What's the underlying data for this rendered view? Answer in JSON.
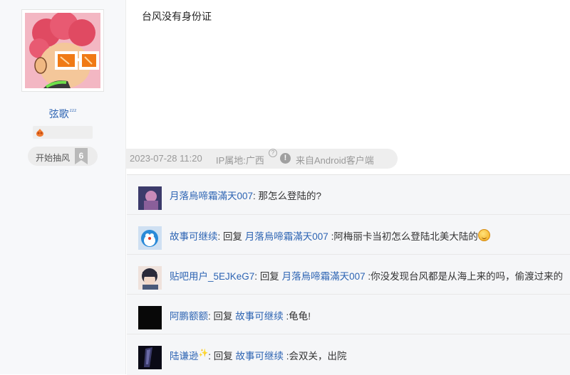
{
  "author": {
    "username": "弦歌",
    "username_suffix": "ᶻᶻᶻ",
    "lottery_label": "开始抽风",
    "lottery_count": "6"
  },
  "post": {
    "text": "台风没有身份证",
    "timestamp": "2023-07-28 11:20",
    "ip_location": "IP属地:广西",
    "help_glyph": "?",
    "warn_glyph": "!",
    "client": "来自Android客户端"
  },
  "comments": [
    {
      "user": "月落烏啼霜滿天007",
      "sep": ": ",
      "reply_word": "",
      "reply_to": "",
      "text": "那怎么登陆的?"
    },
    {
      "user": "故事可继续",
      "sep": ": ",
      "reply_word": "回复 ",
      "reply_to": "月落烏啼霜滿天007",
      "text": " :阿梅丽卡当初怎么登陆北美大陆的"
    },
    {
      "user": "贴吧用户_5EJKeG7",
      "sep": ": ",
      "reply_word": "回复 ",
      "reply_to": "月落烏啼霜滿天007",
      "text": " :你没发现台风都是从海上来的吗，偷渡过来的"
    },
    {
      "user": "阿鹏额额",
      "sep": ": ",
      "reply_word": "回复 ",
      "reply_to": "故事可继续",
      "text": " :龟龟!"
    },
    {
      "user": "陆谦逊",
      "user_suffix": "✨",
      "sep": ": ",
      "reply_word": "回复 ",
      "reply_to": "故事可继续",
      "text": " :会双关，出院"
    }
  ],
  "colors": {
    "link": "#2d64b3",
    "meta_text": "#999999",
    "comment_bg": "#f5f6f8"
  }
}
